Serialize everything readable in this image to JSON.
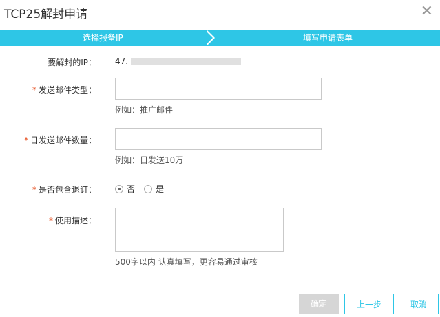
{
  "dialog": {
    "title": "TCP25解封申请",
    "close_icon": "close-icon"
  },
  "steps": [
    {
      "label": "选择报备IP"
    },
    {
      "label": "填写申请表单"
    }
  ],
  "form": {
    "ip_label": "要解封的IP：",
    "ip_value": "47.",
    "mail_type_label": "发送邮件类型：",
    "mail_type_value": "",
    "mail_type_hint": "例如：推广邮件",
    "daily_count_label": "日发送邮件数量：",
    "daily_count_value": "",
    "daily_count_hint": "例如：日发送10万",
    "unsubscribe_label": "是否包含退订：",
    "unsubscribe_options": [
      {
        "label": "否",
        "selected": true
      },
      {
        "label": "是",
        "selected": false
      }
    ],
    "usage_label": "使用描述：",
    "usage_value": "",
    "usage_hint": "500字以内 认真填写，更容易通过审核",
    "required_mark": "*"
  },
  "buttons": {
    "confirm": "确定",
    "prev": "上一步",
    "cancel": "取消"
  },
  "colors": {
    "accent": "#2ec6e6",
    "required": "#e64a19",
    "disabled": "#d6d6d6"
  }
}
